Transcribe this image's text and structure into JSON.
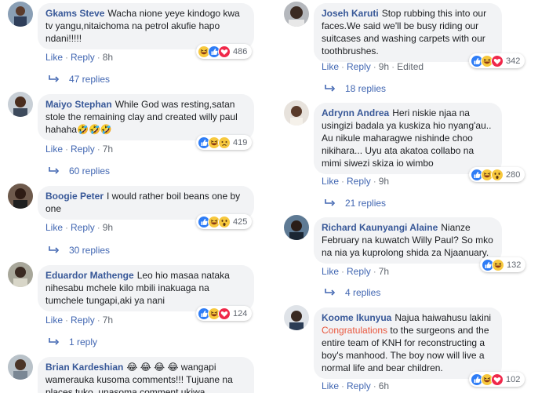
{
  "comments_left": [
    {
      "author": "Gkams Steve",
      "text": "Wacha nione yeye kindogo kwa tv yangu,nitaichoma na petrol akufie hapo ndani!!!!!",
      "like": "Like",
      "reply": "Reply",
      "time": "8h",
      "reaction_count": "486",
      "reactions": [
        "haha",
        "like",
        "love"
      ],
      "replies_label": "47 replies"
    },
    {
      "author": "Maiyo Stephan",
      "text": "While God was resting,satan stole the remaining clay and created willy paul hahaha🤣🤣🤣",
      "like": "Like",
      "reply": "Reply",
      "time": "7h",
      "reaction_count": "419",
      "reactions": [
        "like",
        "haha",
        "sad"
      ],
      "replies_label": "60 replies"
    },
    {
      "author": "Boogie Peter",
      "text": "I would rather boil beans one by one",
      "like": "Like",
      "reply": "Reply",
      "time": "9h",
      "reaction_count": "425",
      "reactions": [
        "like",
        "haha",
        "wow"
      ],
      "replies_label": "30 replies"
    },
    {
      "author": "Eduardor Mathenge",
      "text": "Leo hio masaa nataka nihesabu mchele kilo mbili inakuaga na tumchele tungapi,aki ya nani",
      "like": "Like",
      "reply": "Reply",
      "time": "7h",
      "reaction_count": "124",
      "reactions": [
        "like",
        "haha",
        "love"
      ],
      "replies_label": "1 reply"
    },
    {
      "author": "Brian Kardeshian",
      "text": "😂 😂 😂 😂 wangapi wamerauka kusoma comments!!! Tujuane na places tuko, unasoma comment ukiwa"
    }
  ],
  "comments_right": [
    {
      "author": "Joseh Karuti",
      "text": "Stop rubbing this into our faces.We said we'll be busy riding our suitcases and washing carpets with our toothbrushes.",
      "like": "Like",
      "reply": "Reply",
      "time": "9h",
      "edited": "Edited",
      "reaction_count": "342",
      "reactions": [
        "like",
        "haha",
        "love"
      ],
      "replies_label": "18 replies"
    },
    {
      "author": "Adrynn Andrea",
      "text": "Heri niskie njaa na usingizi badala ya kuskiza hio nyang'au.. Au nikule maharagwe nishinde choo nikihara... Uyu ata akatoa collabo na mimi siwezi skiza io wimbo",
      "like": "Like",
      "reply": "Reply",
      "time": "9h",
      "reaction_count": "280",
      "reactions": [
        "like",
        "haha",
        "wow"
      ],
      "replies_label": "21 replies"
    },
    {
      "author": "Richard Kaunyangi Alaine",
      "text": "Nianze February na kuwatch Willy Paul? So mko na nia ya kuprolong shida za Njaanuary.",
      "like": "Like",
      "reply": "Reply",
      "time": "7h",
      "reaction_count": "132",
      "reactions": [
        "like",
        "haha"
      ],
      "replies_label": "4 replies"
    },
    {
      "author": "Koome Ikunyua",
      "text_before": "Najua haiwahusu lakini",
      "highlight": "Congratulations",
      "text_after": "to the surgeons and the entire team of KNH for reconstructing a boy's manhood. The boy now will live a normal life and bear children.",
      "like": "Like",
      "reply": "Reply",
      "time": "6h",
      "reaction_count": "102",
      "reactions": [
        "like",
        "haha",
        "love"
      ]
    }
  ]
}
